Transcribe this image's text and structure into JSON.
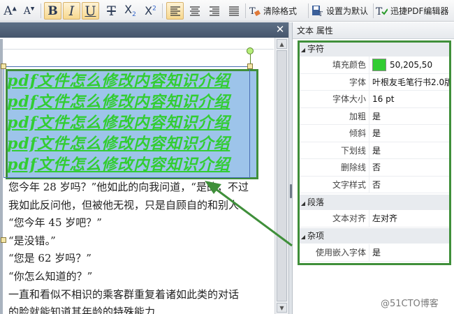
{
  "toolbar": {
    "font_increase_icon": "font-increase-icon",
    "font_decrease_icon": "font-decrease-icon",
    "bold_glyph": "B",
    "italic_glyph": "I",
    "underline_glyph": "U",
    "strike_glyph": "T",
    "subscript_glyph": "X",
    "subscript_index": "2",
    "superscript_glyph": "X",
    "superscript_index": "2",
    "clear_format_label": "清除格式",
    "set_default_label": "设置为默认",
    "editor_label": "迅捷PDF编辑器"
  },
  "document": {
    "highlighted_lines": [
      "pdf文件怎么修改内容知识介绍",
      "pdf文件怎么修改内容知识介绍",
      "pdf文件怎么修改内容知识介绍",
      "pdf文件怎么修改内容知识介绍",
      "pdf文件怎么修改内容知识介绍"
    ],
    "body_lines": [
      "您今年 28 岁吗？”他如此的向我问道，“是的，不过",
      "我如此反问他，但被他无视，只是自顾自的和别人",
      "“您今年 45 岁吧？”",
      "“是没错。”",
      "“您是 62 岁吗？”",
      "“你怎么知道的？”",
      "一直和看似不相识的乘客群重复着诸如此类的对话",
      "的脸就能知道其年龄的特殊能力"
    ]
  },
  "panel": {
    "title": "文本 属性",
    "categories": {
      "character": "字符",
      "paragraph": "段落",
      "misc": "杂项"
    },
    "rows": {
      "fill_color_label": "填充颜色",
      "fill_color_value": "50,205,50",
      "font_label": "字体",
      "font_value": "叶根友毛笔行书2.0版",
      "size_label": "字体大小",
      "size_value": "16 pt",
      "bold_label": "加粗",
      "bold_value": "是",
      "italic_label": "倾斜",
      "italic_value": "是",
      "underline_label": "下划线",
      "underline_value": "是",
      "strike_label": "删除线",
      "strike_value": "否",
      "style_label": "文字样式",
      "style_value": "否",
      "align_label": "文本对齐",
      "align_value": "左对齐",
      "embed_label": "使用嵌入字体",
      "embed_value": "是"
    }
  },
  "colors": {
    "fill_color": "#32cd32",
    "annotation_green": "#3f8f3a",
    "selection_blue": "#9dc4ea"
  },
  "watermark": "@51CTO博客"
}
